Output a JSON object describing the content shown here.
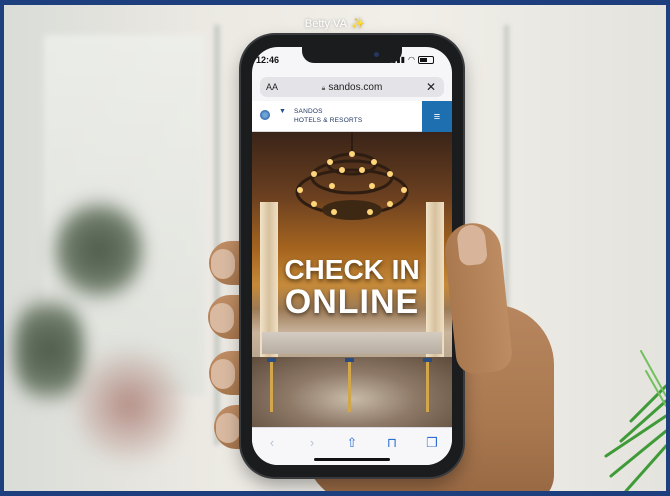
{
  "caption": {
    "name": "Betty VA",
    "sparkle": "✨"
  },
  "phone": {
    "status": {
      "time": "12:46"
    },
    "browser": {
      "text_size_button": "AA",
      "url": "sandos.com",
      "close_button": "✕"
    },
    "site": {
      "logo_line1": "SANDOS",
      "logo_line2": "HOTELS & RESORTS",
      "menu_icon": "≡"
    },
    "hero": {
      "line1": "CHECK IN",
      "line2": "ONLINE"
    },
    "toolbar": {
      "back": "‹",
      "forward": "›",
      "share": "⇧",
      "bookmarks": "⊓",
      "tabs": "❐"
    }
  }
}
